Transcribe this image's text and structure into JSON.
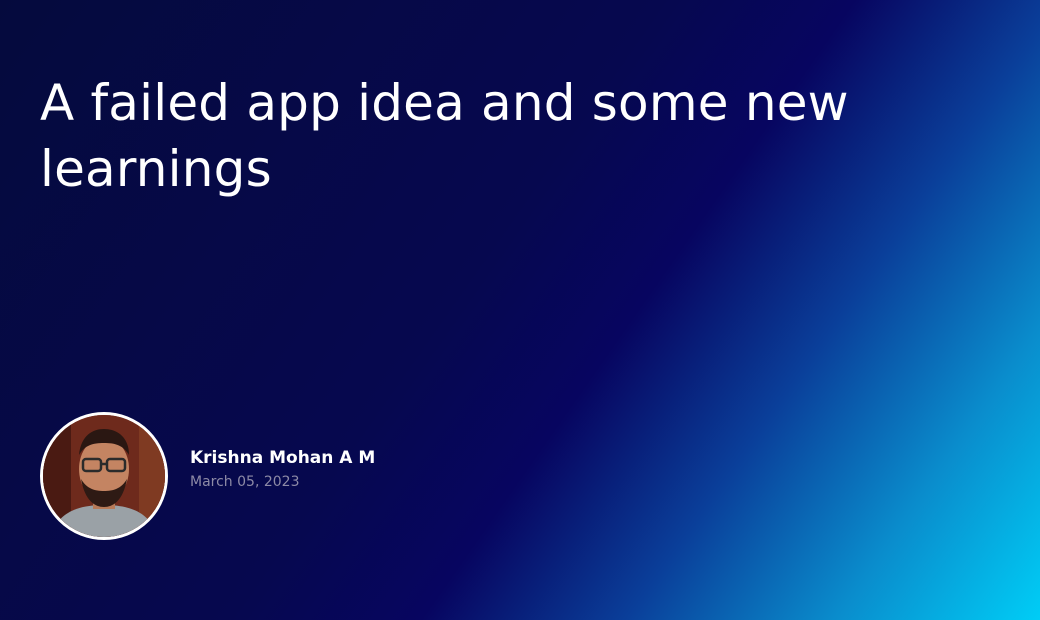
{
  "post": {
    "title": "A failed app idea and some new learnings"
  },
  "author": {
    "name": "Krishna Mohan A M",
    "date": "March 05, 2023",
    "avatar_icon": "author-photo"
  },
  "colors": {
    "background_start": "#050a3d",
    "background_mid": "#070560",
    "background_end": "#00cdf6",
    "title_text": "#ffffff",
    "date_text": "#8d8aa6"
  }
}
